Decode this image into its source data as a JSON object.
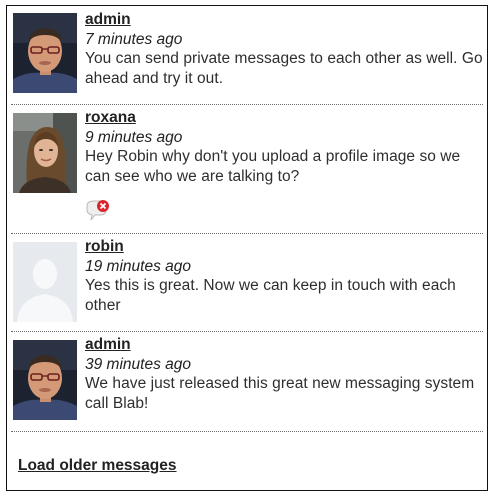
{
  "messages": [
    {
      "username": "admin",
      "time": "7 minutes ago",
      "text": "You can send private messages to each other as well. Go ahead and try it out.",
      "avatar": "admin-photo"
    },
    {
      "username": "roxana",
      "time": "9 minutes ago",
      "text": "Hey Robin why don't you upload a profile image so we can see who we are talking to?",
      "avatar": "roxana-photo",
      "action_icon": "delete-speech-bubble-icon"
    },
    {
      "username": "robin",
      "time": "19 minutes ago",
      "text": "Yes this is great. Now we can keep in touch with each other",
      "avatar": "default-silhouette"
    },
    {
      "username": "admin",
      "time": "39 minutes ago",
      "text": "We have just released this great new messaging system call Blab!",
      "avatar": "admin-photo"
    }
  ],
  "load_older_label": "Load older messages",
  "colors": {
    "text": "#2e2e2e",
    "divider": "#6a6a6a",
    "border": "#111111",
    "delete_red": "#d9262c"
  }
}
